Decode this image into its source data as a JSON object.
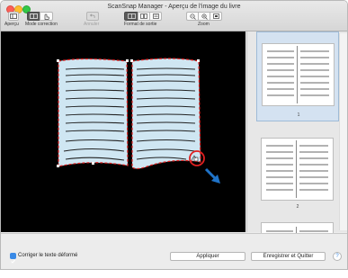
{
  "window": {
    "title": "ScanSnap Manager - Aperçu de l'image du livre"
  },
  "toolbar": {
    "apercu_label": "Aperçu",
    "mode_correction_label": "Mode correction",
    "annuler_label": "Annuler",
    "format_sortie_label": "Format de sortie",
    "zoom_label": "Zoom"
  },
  "thumbnails": [
    {
      "page": "1"
    },
    {
      "page": "2"
    }
  ],
  "bottom": {
    "checkbox_label": "Corriger le texte déformé",
    "checkbox_checked": true,
    "apply_label": "Appliquer",
    "save_quit_label": "Enregistrer et Quitter",
    "help_label": "?"
  },
  "colors": {
    "accent": "#3a8ae6",
    "page_fill": "#cfe6f2",
    "outline": "#e02020"
  }
}
